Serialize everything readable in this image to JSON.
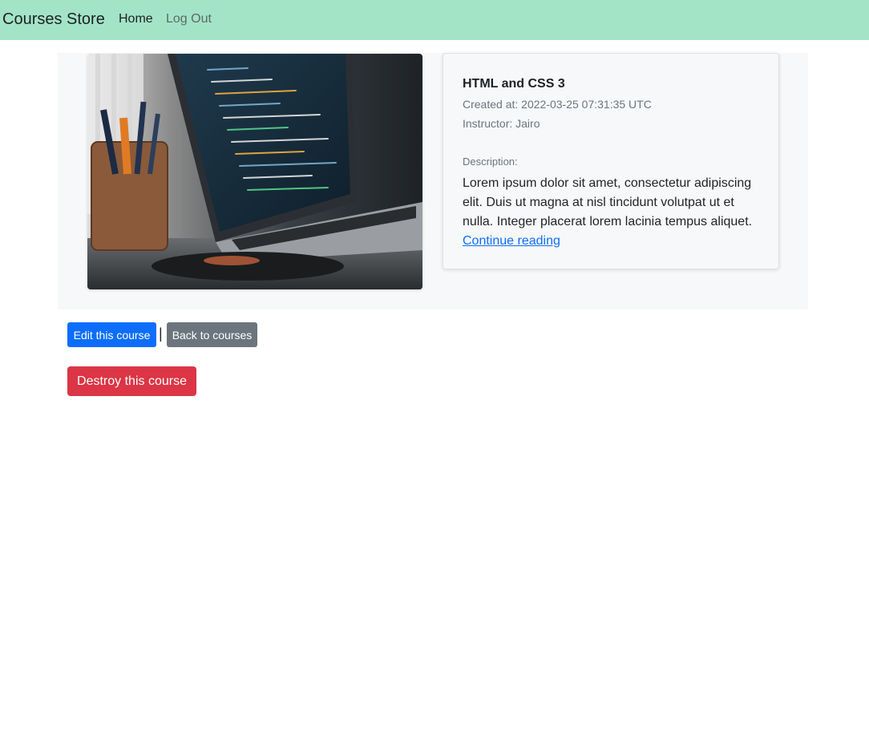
{
  "navbar": {
    "brand": "Courses Store",
    "links": [
      {
        "label": "Home"
      },
      {
        "label": "Log Out"
      }
    ]
  },
  "course": {
    "title": "HTML and CSS 3",
    "created": "Created at: 2022-03-25 07:31:35 UTC",
    "instructor": "Instructor: Jairo",
    "description_label": "Description:",
    "description": "Lorem ipsum dolor sit amet, consectetur adipiscing elit. Duis ut magna at nisl tincidunt volutpat ut et nulla. Integer placerat lorem lacinia tempus aliquet.",
    "continue_label": "Continue reading"
  },
  "actions": {
    "edit_label": "Edit this course",
    "separator": "|",
    "back_label": "Back to courses",
    "destroy_label": "Destroy this course"
  },
  "colors": {
    "navbar_bg": "#a3e4c7",
    "primary": "#0d6efd",
    "secondary": "#6c757d",
    "danger": "#dc3545"
  }
}
